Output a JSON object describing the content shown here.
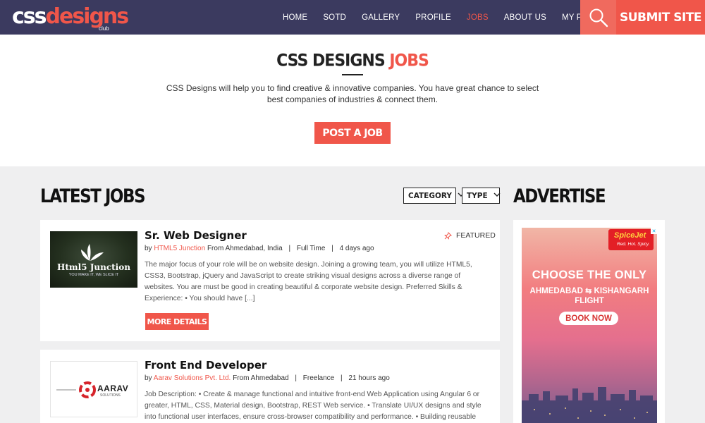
{
  "header": {
    "logo": {
      "part1": "css",
      "part2": "designs",
      "sub": "club"
    },
    "nav": [
      "HOME",
      "SOTD",
      "GALLERY",
      "PROFILE",
      "JOBS",
      "ABOUT US",
      "MY PROFILE"
    ],
    "active_nav": "JOBS",
    "submit_label": "SUBMIT SITE"
  },
  "hero": {
    "title_main": "CSS DESIGNS",
    "title_accent": "JOBS",
    "description": "CSS Designs will help you to find creative & innovative companies. You have great chance to select best companies of industries & connect them.",
    "post_button": "POST A JOB"
  },
  "latest": {
    "title": "LATEST JOBS",
    "filters": [
      "CATEGORY",
      "TYPE"
    ]
  },
  "jobs": [
    {
      "title": "Sr. Web Designer",
      "by": "by",
      "company": "HTML5 Junction",
      "location": "From Ahmedabad, India",
      "type": "Full Time",
      "posted": "4 days ago",
      "featured_label": "FEATURED",
      "logo_text": "Html5 Junction",
      "logo_tagline": "YOU MAKE IT, WE SLICE IT",
      "description": "The major focus of your role will be on website design. Joining a growing team, you will utilize HTML5, CSS3, Bootstrap, jQuery and JavaScript to create striking visual designs across a diverse range of websites. You are must be good in creating beautiful & corporate website design. Preferred Skills & Experience: • You should have [...]",
      "button": "MORE DETAILS"
    },
    {
      "title": "Front End Developer",
      "by": "by",
      "company": "Aarav Solutions Pvt. Ltd.",
      "location": "From Ahmedabad",
      "type": "Freelance",
      "posted": "21 hours ago",
      "logo_text": "AARAV",
      "logo_tagline": "SOLUTIONS",
      "description": "Job Description: • Create & manage functional and intuitive front-end Web Application using Angular 6 or greater, HTML, CSS, Material design, Bootstrap, REST Web service. • Translate UI/UX designs and style into functional user interfaces, ensure cross-browser compatibility and performance. • Building reusable"
    }
  ],
  "advertise": {
    "title": "ADVERTISE",
    "brand": "SpiceJet",
    "brand_tag": "Red. Hot. Spicy.",
    "headline": "CHOOSE THE ONLY",
    "route_from": "AHMEDABAD",
    "route_to": "KISHANGARH",
    "route_flight": "FLIGHT",
    "cta": "BOOK NOW"
  },
  "colors": {
    "header_bg": "#3b3a5f",
    "accent": "#f0564a",
    "page_bg": "#efeff0"
  }
}
